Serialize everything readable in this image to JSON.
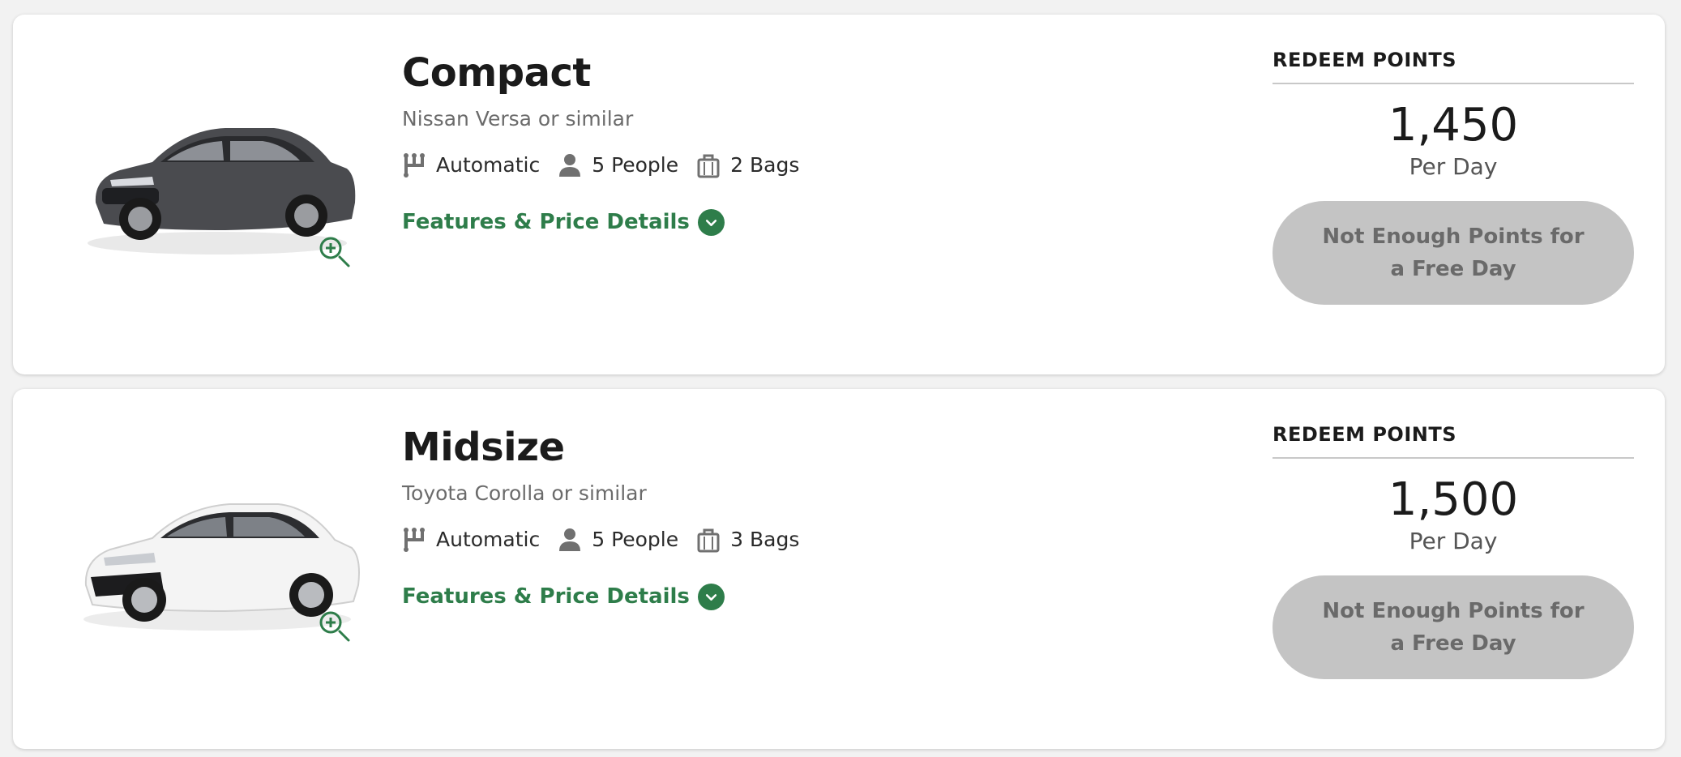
{
  "colors": {
    "accent_green": "#2e7d4a",
    "disabled_button": "#c4c4c4",
    "page_background": "#f2f2f2"
  },
  "vehicles": [
    {
      "class_name": "Compact",
      "model": "Nissan Versa or similar",
      "car_color": "dark-gray",
      "transmission": "Automatic",
      "people": "5 People",
      "bags": "2 Bags",
      "details_link": "Features & Price Details",
      "redeem_title": "REDEEM POINTS",
      "points": "1,450",
      "per_day": "Per Day",
      "button_label": "Not Enough Points for a Free Day"
    },
    {
      "class_name": "Midsize",
      "model": "Toyota Corolla or similar",
      "car_color": "white",
      "transmission": "Automatic",
      "people": "5 People",
      "bags": "3 Bags",
      "details_link": "Features & Price Details",
      "redeem_title": "REDEEM POINTS",
      "points": "1,500",
      "per_day": "Per Day",
      "button_label": "Not Enough Points for a Free Day"
    }
  ],
  "icons": {
    "zoom": "zoom-in-icon",
    "transmission": "gear-shift-icon",
    "people": "person-icon",
    "bags": "bag-icon",
    "chevron": "chevron-down-icon"
  }
}
